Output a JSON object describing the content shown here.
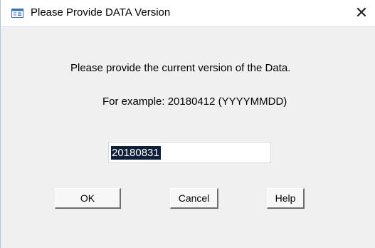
{
  "window": {
    "title": "Please Provide DATA Version",
    "icon": "form-icon",
    "close_symbol": "✕"
  },
  "dialog": {
    "prompt": "Please provide the current version of the Data.",
    "example": "For example:  20180412 (YYYYMMDD)",
    "input_value": "20180831",
    "input_selected": true
  },
  "buttons": {
    "ok": "OK",
    "cancel": "Cancel",
    "help": "Help"
  },
  "colors": {
    "accent": "#3c6fb4",
    "selection": "#0f1f3a"
  }
}
